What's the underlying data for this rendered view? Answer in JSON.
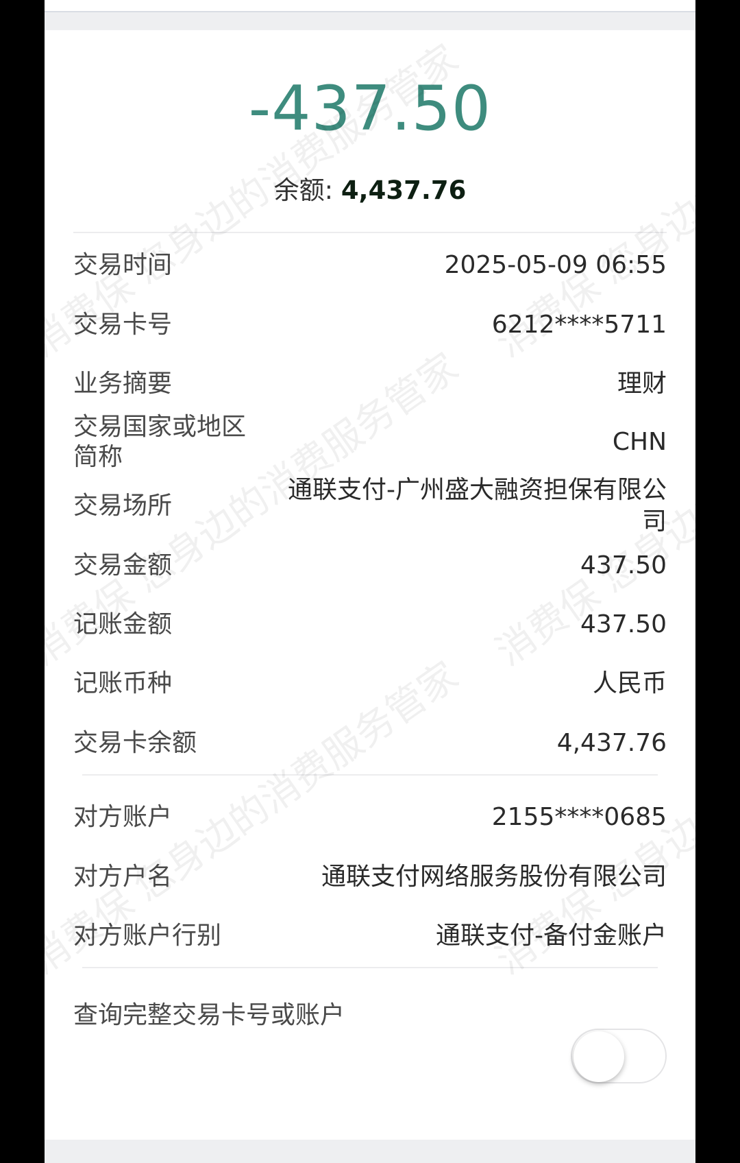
{
  "transaction": {
    "amount": "-437.50",
    "balance_label": "余额: ",
    "balance_value": "4,437.76"
  },
  "details": [
    {
      "label": "交易时间",
      "value": "2025-05-09 06:55"
    },
    {
      "label": "交易卡号",
      "value": "6212****5711"
    },
    {
      "label": "业务摘要",
      "value": "理财"
    },
    {
      "label": "交易国家或地区简称",
      "value": "CHN"
    },
    {
      "label": "交易场所",
      "value": "通联支付-广州盛大融资担保有限公司"
    },
    {
      "label": "交易金额",
      "value": "437.50"
    },
    {
      "label": "记账金额",
      "value": "437.50"
    },
    {
      "label": "记账币种",
      "value": "人民币"
    },
    {
      "label": "交易卡余额",
      "value": "4,437.76"
    }
  ],
  "counterparty": [
    {
      "label": "对方账户",
      "value": "2155****0685"
    },
    {
      "label": "对方户名",
      "value": "通联支付网络服务股份有限公司"
    },
    {
      "label": "对方账户行别",
      "value": "通联支付-备付金账户"
    }
  ],
  "query_toggle": {
    "label": "查询完整交易卡号或账户",
    "state": "off"
  },
  "watermark": {
    "text": "消费保 您身边的消费服务管家"
  },
  "colors": {
    "amount": "#3e8c7e",
    "balance": "#0d1f12",
    "background": "#eeeff1"
  }
}
